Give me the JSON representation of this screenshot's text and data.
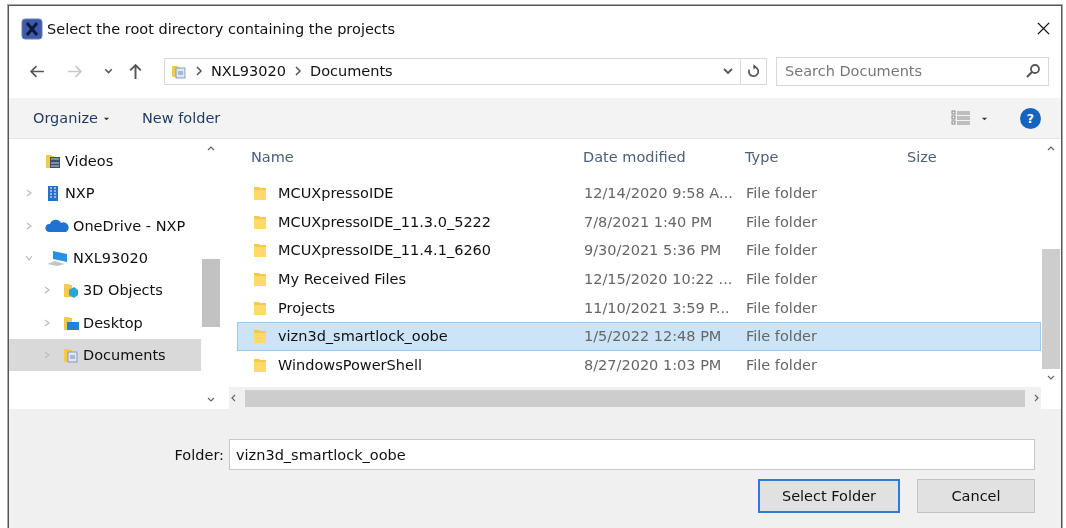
{
  "window": {
    "title": "Select the root directory containing the projects"
  },
  "address": {
    "path": [
      {
        "label": "NXL93020"
      },
      {
        "label": "Documents"
      }
    ]
  },
  "search": {
    "placeholder": "Search Documents"
  },
  "toolbar": {
    "organize": "Organize",
    "new_folder": "New folder",
    "help": "?"
  },
  "sidebar": {
    "items": [
      {
        "label": "Videos",
        "kind": "videos",
        "expandable": false,
        "selected": false
      },
      {
        "label": "NXP",
        "kind": "building",
        "expandable": true,
        "expanded": false,
        "selected": false
      },
      {
        "label": "OneDrive - NXP",
        "kind": "cloud",
        "expandable": true,
        "expanded": false,
        "selected": false
      },
      {
        "label": "NXL93020",
        "kind": "computer",
        "expandable": true,
        "expanded": true,
        "selected": false,
        "children": [
          {
            "label": "3D Objects",
            "kind": "objects",
            "expandable": true,
            "selected": false
          },
          {
            "label": "Desktop",
            "kind": "desktop",
            "expandable": true,
            "selected": false
          },
          {
            "label": "Documents",
            "kind": "documents",
            "expandable": true,
            "selected": true
          }
        ]
      }
    ]
  },
  "table": {
    "columns": [
      "Name",
      "Date modified",
      "Type",
      "Size"
    ],
    "rows": [
      {
        "name": "MCUXpressoIDE",
        "date": "12/14/2020 9:58 A...",
        "type": "File folder",
        "selected": false
      },
      {
        "name": "MCUXpressoIDE_11.3.0_5222",
        "date": "7/8/2021 1:40 PM",
        "type": "File folder",
        "selected": false
      },
      {
        "name": "MCUXpressoIDE_11.4.1_6260",
        "date": "9/30/2021 5:36 PM",
        "type": "File folder",
        "selected": false
      },
      {
        "name": "My Received Files",
        "date": "12/15/2020 10:22 ...",
        "type": "File folder",
        "selected": false
      },
      {
        "name": "Projects",
        "date": "11/10/2021 3:59 P...",
        "type": "File folder",
        "selected": false
      },
      {
        "name": "vizn3d_smartlock_oobe",
        "date": "1/5/2022 12:48 PM",
        "type": "File folder",
        "selected": true
      },
      {
        "name": "WindowsPowerShell",
        "date": "8/27/2020 1:03 PM",
        "type": "File folder",
        "selected": false
      }
    ]
  },
  "folder_field": {
    "label": "Folder:",
    "value": "vizn3d_smartlock_oobe"
  },
  "buttons": [
    {
      "label": "Select Folder",
      "kind": "primary"
    },
    {
      "label": "Cancel",
      "kind": "normal"
    }
  ]
}
